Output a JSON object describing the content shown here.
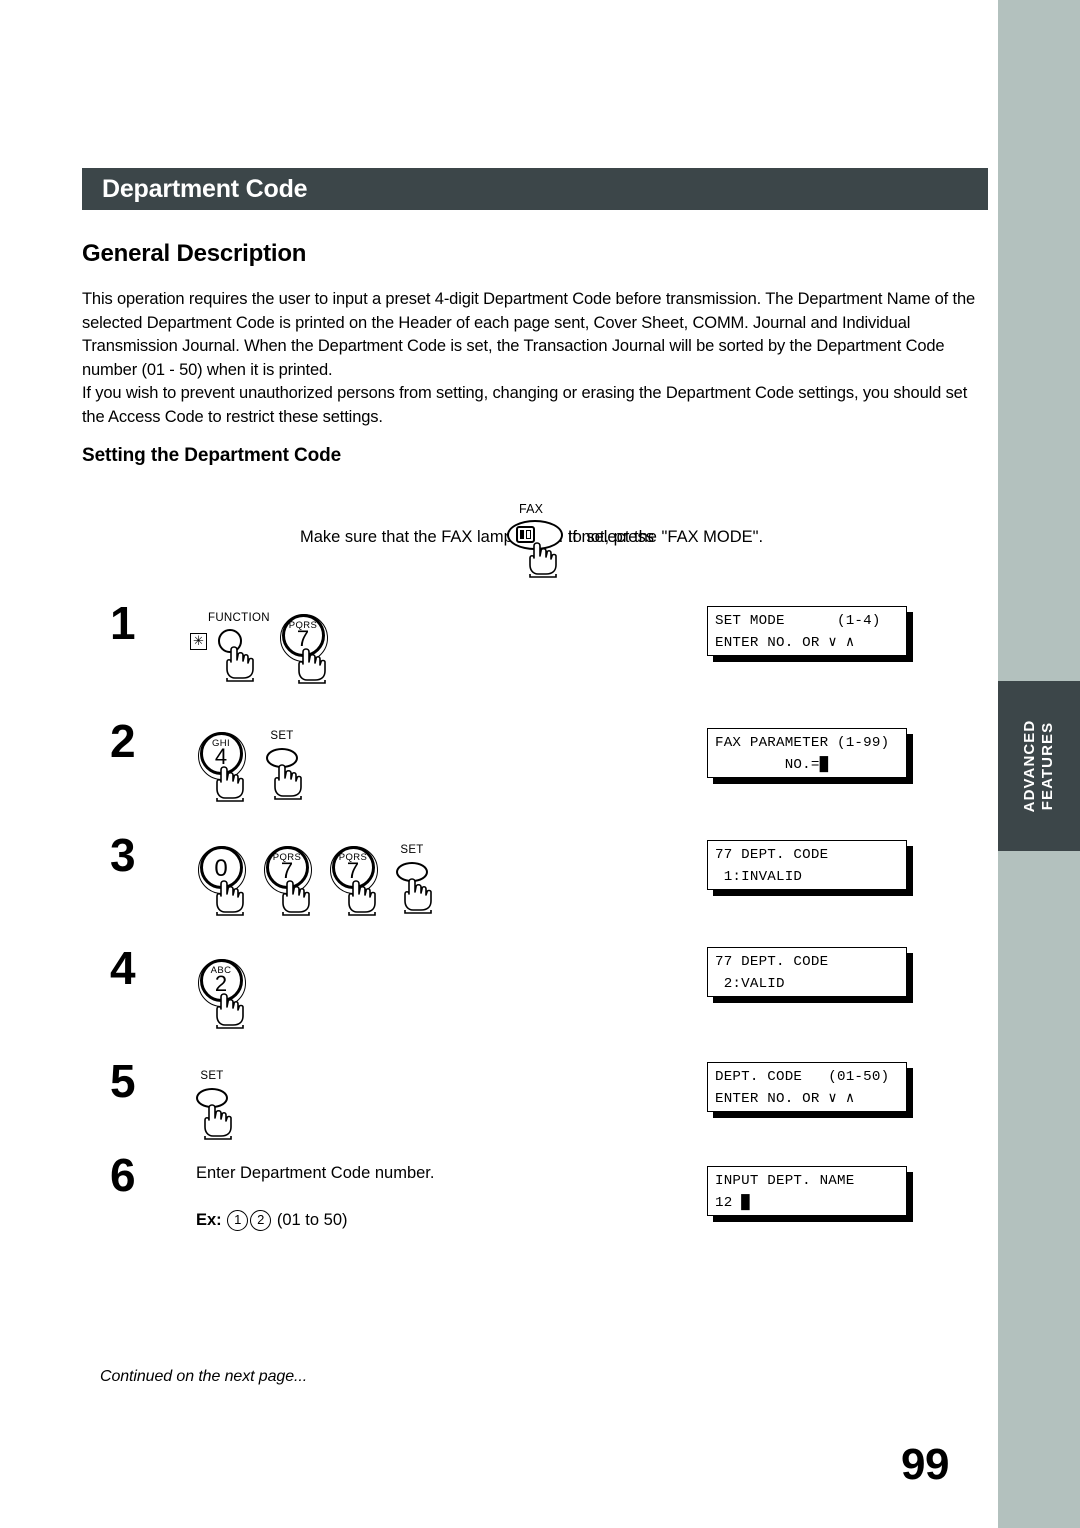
{
  "document": {
    "section_title": "Department Code",
    "page_number": "99",
    "continued_note": "Continued on the next page...",
    "side_tab": {
      "line1": "ADVANCED",
      "line2": "FEATURES"
    },
    "colors": {
      "title_bar": "#3c4649",
      "side_strip": "#b3c1be",
      "side_tab": "#3c4649"
    }
  },
  "general_description": {
    "heading": "General Description",
    "paragraphs": [
      "This operation requires the user to input a preset 4-digit Department Code before transmission.  The Department Name of the selected Department Code is printed on the Header of each page sent, Cover Sheet, COMM. Journal and Individual Transmission Journal.  When the Department Code is set, the Transaction Journal will be sorted by the Department Code number (01 - 50) when it is printed.",
      "If you wish to prevent unauthorized persons from setting, changing or erasing the Department Code settings, you should set the Access Code to restrict these settings."
    ]
  },
  "setting_section": {
    "heading": "Setting the Department Code",
    "fax_instruction": {
      "before": "Make sure that the FAX lamp is ON.  If not, press",
      "key_label": "FAX",
      "after": "to select the \"FAX MODE\"."
    }
  },
  "steps": [
    {
      "number": "1",
      "keys": [
        {
          "type": "function",
          "label": "FUNCTION",
          "star": "✳"
        },
        {
          "type": "numeric",
          "letters": "PQRS",
          "digit": "7"
        }
      ],
      "lcd": {
        "line1": "SET MODE      (1-4)",
        "line2": "ENTER NO. OR ∨ ∧"
      }
    },
    {
      "number": "2",
      "keys": [
        {
          "type": "numeric",
          "letters": "GHI",
          "digit": "4"
        },
        {
          "type": "set",
          "label": "SET"
        }
      ],
      "lcd": {
        "line1": "FAX PARAMETER (1-99)",
        "line2": "        NO.=█"
      }
    },
    {
      "number": "3",
      "keys": [
        {
          "type": "numeric",
          "letters": "",
          "digit": "0"
        },
        {
          "type": "numeric",
          "letters": "PQRS",
          "digit": "7"
        },
        {
          "type": "numeric",
          "letters": "PQRS",
          "digit": "7"
        },
        {
          "type": "set",
          "label": "SET"
        }
      ],
      "lcd": {
        "line1": "77 DEPT. CODE",
        "line2": " 1:INVALID"
      }
    },
    {
      "number": "4",
      "keys": [
        {
          "type": "numeric",
          "letters": "ABC",
          "digit": "2"
        }
      ],
      "lcd": {
        "line1": "77 DEPT. CODE",
        "line2": " 2:VALID"
      }
    },
    {
      "number": "5",
      "keys": [
        {
          "type": "set",
          "label": "SET"
        }
      ],
      "lcd": {
        "line1": "DEPT. CODE   (01-50)",
        "line2": "ENTER NO. OR ∨ ∧"
      }
    },
    {
      "number": "6",
      "instruction": "Enter Department Code number.",
      "example": {
        "label": "Ex:",
        "digit1": "1",
        "digit2": "2",
        "range": "(01 to 50)"
      },
      "lcd": {
        "line1": "INPUT DEPT. NAME",
        "line2": "12 █"
      }
    }
  ]
}
